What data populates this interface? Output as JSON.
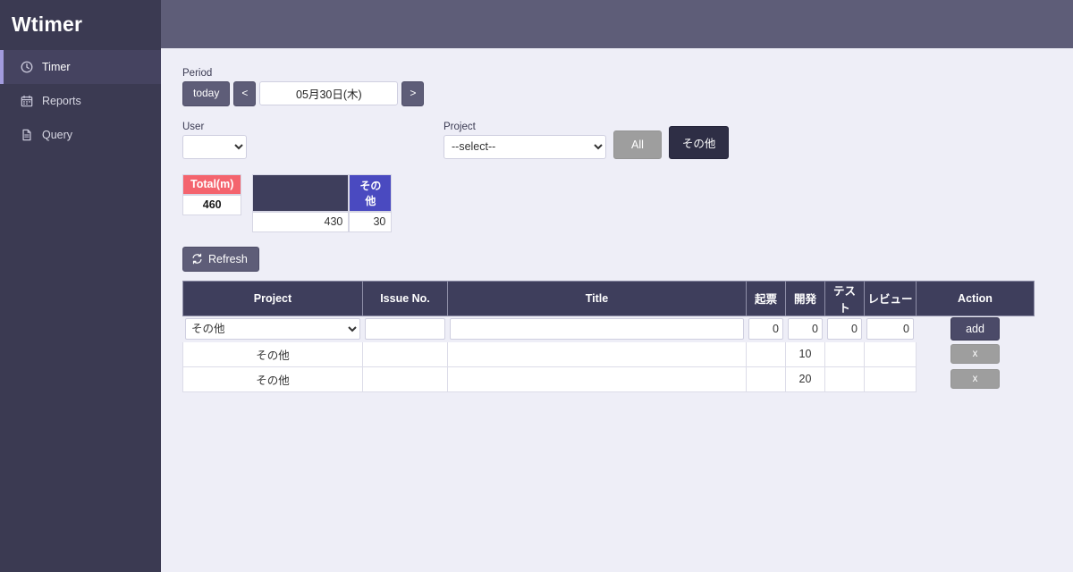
{
  "app": {
    "brand": "Wtimer"
  },
  "sidebar": {
    "items": [
      {
        "label": "Timer",
        "icon": "clock-icon",
        "active": true
      },
      {
        "label": "Reports",
        "icon": "calendar-icon",
        "active": false
      },
      {
        "label": "Query",
        "icon": "document-icon",
        "active": false
      }
    ]
  },
  "filters": {
    "period_label": "Period",
    "today_label": "today",
    "prev_label": "<",
    "next_label": ">",
    "date_value": "05月30日(木)",
    "user_label": "User",
    "user_value": "",
    "project_label": "Project",
    "project_value": "--select--",
    "all_label": "All",
    "other_label": "その他"
  },
  "totals": {
    "total_header": "Total(m)",
    "total_value": "460",
    "breakdown_blank_header": "",
    "breakdown_blank_value": "430",
    "other_header": "その他",
    "other_value": "30"
  },
  "refresh": {
    "label": "Refresh",
    "icon": "refresh-icon"
  },
  "grid": {
    "columns": [
      "Project",
      "Issue No.",
      "Title",
      "起票",
      "開発",
      "テスト",
      "レビュー",
      "Action"
    ],
    "input_row": {
      "project": "その他",
      "issue_no": "",
      "title": "",
      "kihyo": "0",
      "kaihatsu": "0",
      "test": "0",
      "review": "0",
      "action_label": "add"
    },
    "rows": [
      {
        "project": "その他",
        "issue_no": "",
        "title": "",
        "kihyo": "",
        "kaihatsu": "10",
        "test": "",
        "review": "",
        "action_label": "x"
      },
      {
        "project": "その他",
        "issue_no": "",
        "title": "",
        "kihyo": "",
        "kaihatsu": "20",
        "test": "",
        "review": "",
        "action_label": "x"
      }
    ]
  },
  "colors": {
    "sidebar": "#3b3a52",
    "topbar": "#5e5d78",
    "content_bg": "#eeeef7",
    "accent": "#a29bde",
    "total_header": "#f4646e",
    "other_header": "#4a4ac0",
    "grid_header": "#3e3e5c"
  }
}
